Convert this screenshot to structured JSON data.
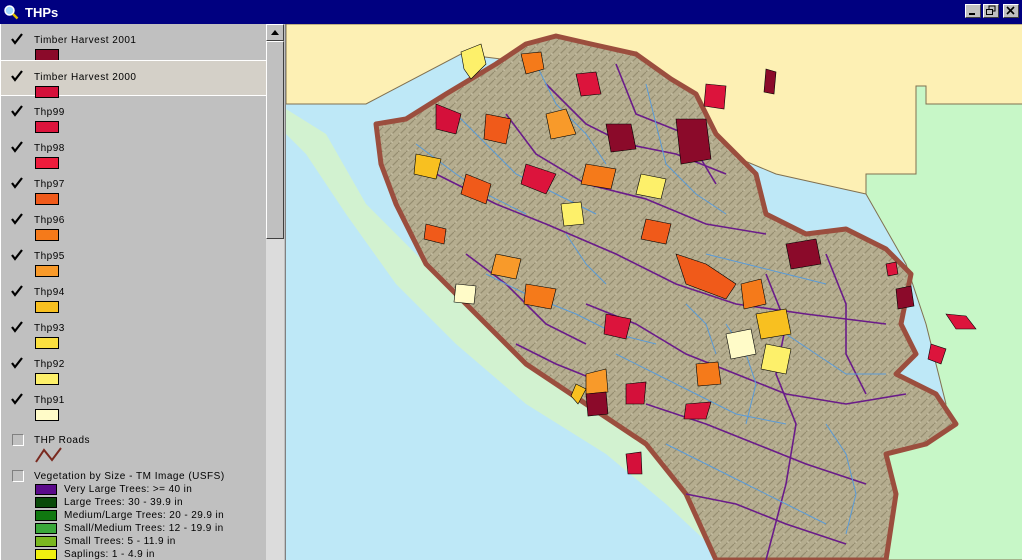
{
  "window": {
    "title": "THPs",
    "controls": [
      "minimize",
      "maximize",
      "close"
    ]
  },
  "colors": {
    "titlebar": "#000080",
    "ocean": "#bee8f7",
    "county_north": "#fdf0b4",
    "county_east": "#c7f7c7",
    "terrain": "#b5ad8f",
    "boundary": "#9b4e3e",
    "streams": "#5a9bd8",
    "watersheds": "#6a1b8a"
  },
  "legend": {
    "layers": [
      {
        "label": "Timber Harvest 2001",
        "checked": true,
        "color": "#8b0a2a"
      },
      {
        "label": "Timber Harvest 2000",
        "checked": true,
        "color": "#d4103a",
        "selected": true
      },
      {
        "label": "Thp99",
        "checked": true,
        "color": "#dc143c"
      },
      {
        "label": "Thp98",
        "checked": true,
        "color": "#ee1c3c"
      },
      {
        "label": "Thp97",
        "checked": true,
        "color": "#f05a1a"
      },
      {
        "label": "Thp96",
        "checked": true,
        "color": "#f57a1a"
      },
      {
        "label": "Thp95",
        "checked": true,
        "color": "#f89a2a"
      },
      {
        "label": "Thp94",
        "checked": true,
        "color": "#f8c020"
      },
      {
        "label": "Thp93",
        "checked": true,
        "color": "#fbe040"
      },
      {
        "label": "Thp92",
        "checked": true,
        "color": "#fdf06a"
      },
      {
        "label": "Thp91",
        "checked": true,
        "color": "#fffbc8"
      }
    ],
    "thp_roads": {
      "label": "THP Roads",
      "checked": false
    },
    "vegetation": {
      "label": "Vegetation by Size - TM Image (USFS)",
      "checked": false,
      "classes": [
        {
          "label": "Very Large Trees: >= 40  in",
          "color": "#5a0a8a"
        },
        {
          "label": "Large Trees: 30 - 39.9 in",
          "color": "#0a4a0a"
        },
        {
          "label": "Medium/Large Trees: 20 - 29.9 in",
          "color": "#107810"
        },
        {
          "label": "Small/Medium Trees: 12 - 19.9 in",
          "color": "#3aa83a"
        },
        {
          "label": "Small Trees: 5 - 11.9 in",
          "color": "#7ab820"
        },
        {
          "label": "Saplings: 1 - 4.9 in",
          "color": "#f0f010"
        }
      ]
    }
  }
}
